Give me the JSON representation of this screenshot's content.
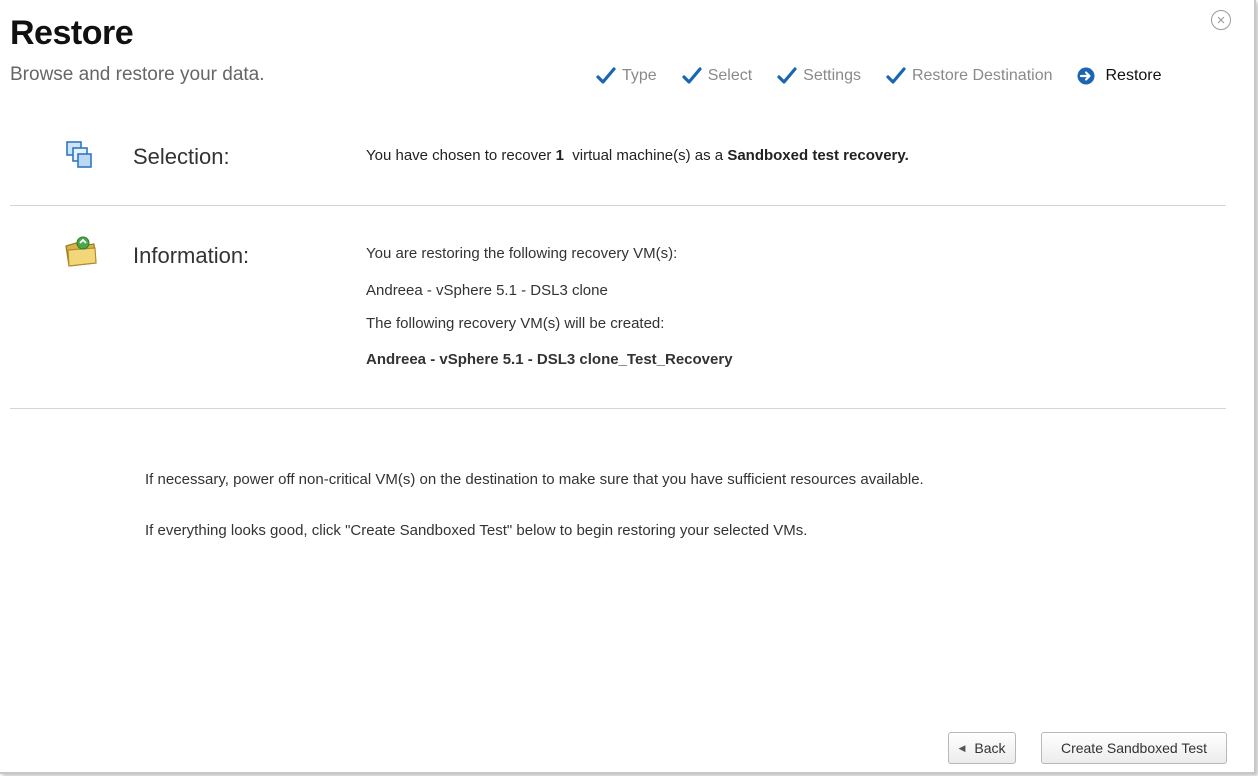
{
  "dialog": {
    "title": "Restore",
    "subtitle": "Browse and restore your data.",
    "close_icon": "close-circle-icon",
    "close_glyph": "×"
  },
  "steps": [
    {
      "label": "Type",
      "state": "done",
      "icon": "checkmark-icon"
    },
    {
      "label": "Select",
      "state": "done",
      "icon": "checkmark-icon"
    },
    {
      "label": "Settings",
      "state": "done",
      "icon": "checkmark-icon"
    },
    {
      "label": "Restore Destination",
      "state": "done",
      "icon": "checkmark-icon"
    },
    {
      "label": "Restore",
      "state": "current",
      "icon": "arrow-circle-icon"
    }
  ],
  "selection": {
    "label": "Selection:",
    "icon": "virtual-machines-icon",
    "text_before": "You have chosen to recover ",
    "count": "1",
    "text_middle": "  virtual machine(s) as a ",
    "mode": "Sandboxed test recovery."
  },
  "information": {
    "label": "Information:",
    "icon": "folder-recovery-icon",
    "restoring_heading": "You are restoring the following recovery VM(s):",
    "source_vm": "Andreea - vSphere 5.1 - DSL3 clone",
    "created_heading": "The following recovery VM(s) will be created:",
    "target_vm": "Andreea - vSphere 5.1 - DSL3 clone_Test_Recovery"
  },
  "notes": {
    "power_off": "If necessary, power off non-critical VM(s) on the destination to make sure that you have sufficient resources available.",
    "confirm": "If everything looks good, click \"Create Sandboxed Test\" below to begin restoring your selected VMs."
  },
  "buttons": {
    "back_label": "Back",
    "back_glyph": "◀",
    "create_label": "Create Sandboxed Test"
  },
  "colors": {
    "accent": "#1a66b3",
    "step_done_text": "#8a8a8a",
    "step_current_text": "#111111"
  }
}
